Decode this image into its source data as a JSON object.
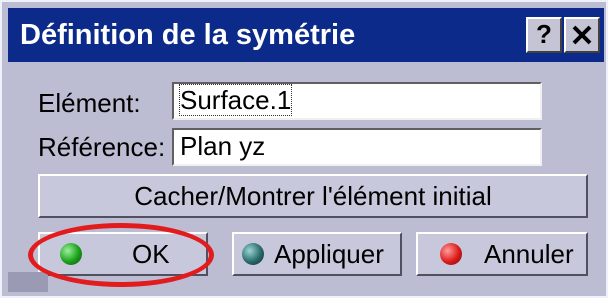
{
  "dialog": {
    "title": "Définition de la symétrie",
    "help_label": "?",
    "colors": {
      "titlebar": "#0c2a8a",
      "panel": "#bcbcd2",
      "highlight": "#e21c1c"
    }
  },
  "form": {
    "element_label": "Elément:",
    "element_value": "Surface.1",
    "reference_label": "Référence:",
    "reference_value": "Plan yz"
  },
  "buttons": {
    "toggle_label": "Cacher/Montrer l'élément initial",
    "ok_label": "OK",
    "apply_label": "Appliquer",
    "cancel_label": "Annuler"
  }
}
